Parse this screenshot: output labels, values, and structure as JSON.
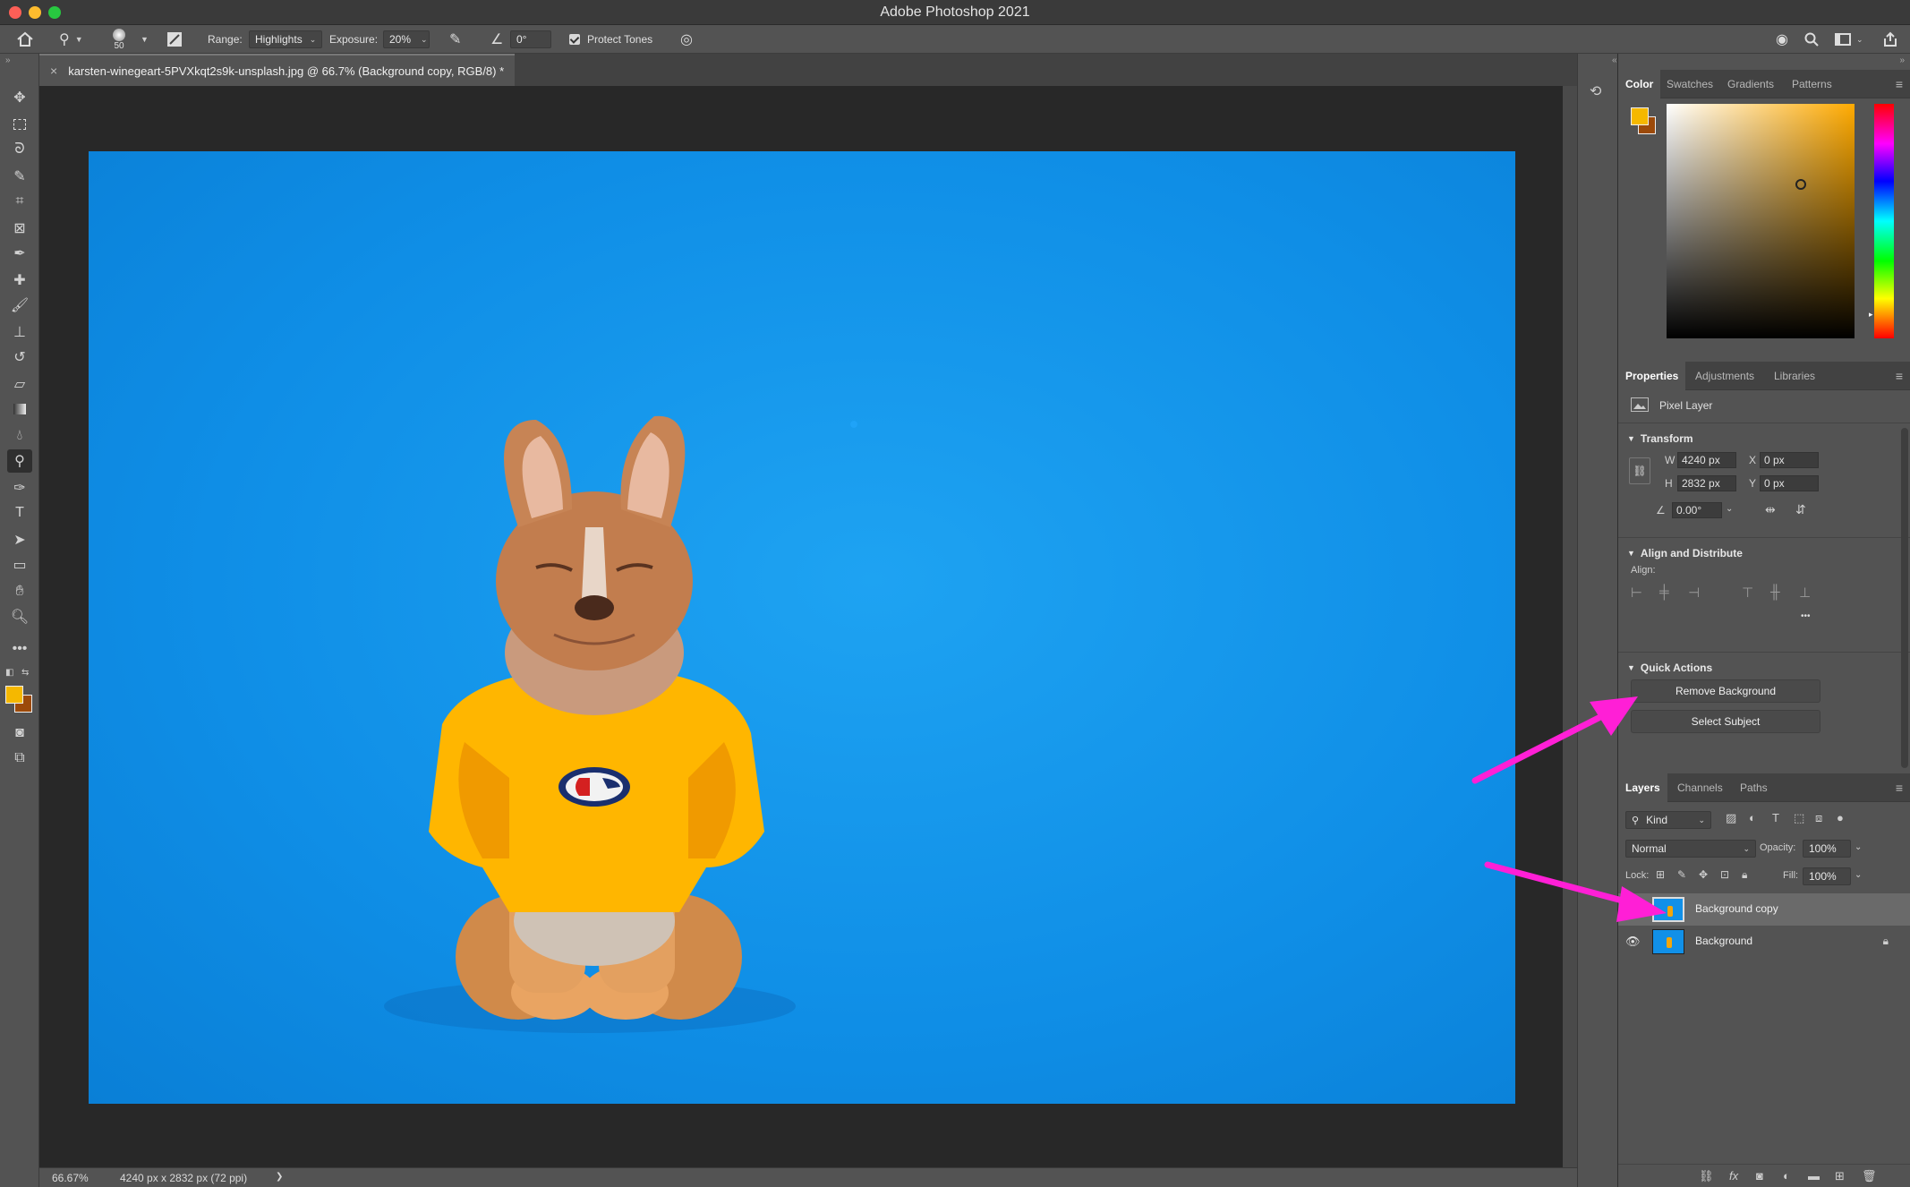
{
  "app": {
    "window_title": "Adobe Photoshop 2021"
  },
  "options_bar": {
    "brush_size": "50",
    "range_label": "Range:",
    "range_value": "Highlights",
    "exposure_label": "Exposure:",
    "exposure_value": "20%",
    "angle_value": "0°",
    "protect_tones_label": "Protect Tones"
  },
  "document": {
    "tab_title": "karsten-winegeart-5PVXkqt2s9k-unsplash.jpg @ 66.7% (Background copy, RGB/8) *",
    "close_glyph": "×"
  },
  "status_bar": {
    "zoom": "66.67%",
    "doc_info": "4240 px x 2832 px (72 ppi)",
    "arrow": "❯"
  },
  "color_panel": {
    "tabs": [
      "Color",
      "Swatches",
      "Gradients",
      "Patterns"
    ],
    "foreground": "#f5b800",
    "background": "#9c4a0a"
  },
  "properties_panel": {
    "tabs": [
      "Properties",
      "Adjustments",
      "Libraries"
    ],
    "layer_type": "Pixel Layer",
    "transform": {
      "title": "Transform",
      "w_label": "W",
      "w_value": "4240 px",
      "h_label": "H",
      "h_value": "2832 px",
      "x_label": "X",
      "x_value": "0 px",
      "y_label": "Y",
      "y_value": "0 px",
      "angle_value": "0.00°"
    },
    "align": {
      "title": "Align and Distribute",
      "label": "Align:",
      "more": "•••"
    },
    "quick_actions": {
      "title": "Quick Actions",
      "remove_background": "Remove Background",
      "select_subject": "Select Subject"
    }
  },
  "layers_panel": {
    "tabs": [
      "Layers",
      "Channels",
      "Paths"
    ],
    "filter_kind": "Kind",
    "blend_mode": "Normal",
    "opacity_label": "Opacity:",
    "opacity_value": "100%",
    "lock_label": "Lock:",
    "fill_label": "Fill:",
    "fill_value": "100%",
    "layers": [
      {
        "name": "Background copy",
        "selected": true
      },
      {
        "name": "Background",
        "selected": false,
        "locked": true
      }
    ]
  },
  "colors": {
    "annotation_arrow": "#ff1fd6",
    "canvas_blue": "#1195ea"
  }
}
